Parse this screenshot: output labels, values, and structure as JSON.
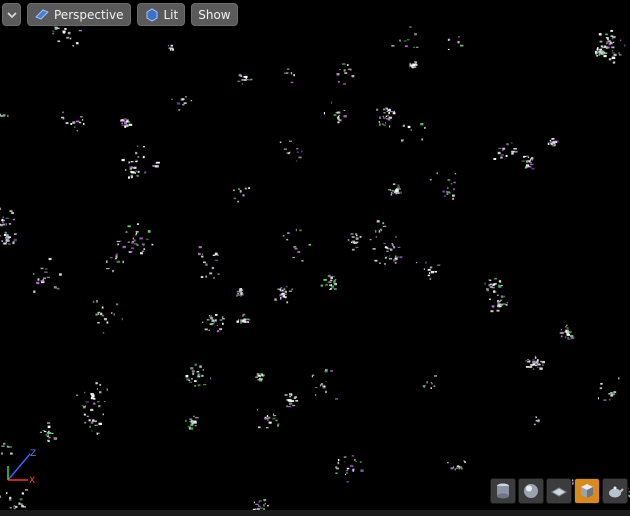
{
  "toolbar": {
    "menu_icon": "chevron-down-icon",
    "perspective_label": "Perspective",
    "perspective_icon": "perspective-cube-icon",
    "lit_label": "Lit",
    "lit_icon": "lit-mode-icon",
    "show_label": "Show"
  },
  "axis": {
    "z_label": "Z",
    "x_label": "X"
  },
  "view_mode_buttons": [
    {
      "name": "cylinder-view-button",
      "icon": "cylinder-icon",
      "active": false
    },
    {
      "name": "sphere-view-button",
      "icon": "sphere-icon",
      "active": false
    },
    {
      "name": "plane-view-button",
      "icon": "plane-icon",
      "active": false
    },
    {
      "name": "cube-view-button",
      "icon": "cube-icon",
      "active": true
    },
    {
      "name": "custom-mesh-view-button",
      "icon": "teapot-icon",
      "active": false
    }
  ],
  "colors": {
    "background": "#000000",
    "particle_white": "#ffffff",
    "particle_purple": "#c070e0",
    "particle_green": "#60e070",
    "active_button": "#d98a18"
  }
}
